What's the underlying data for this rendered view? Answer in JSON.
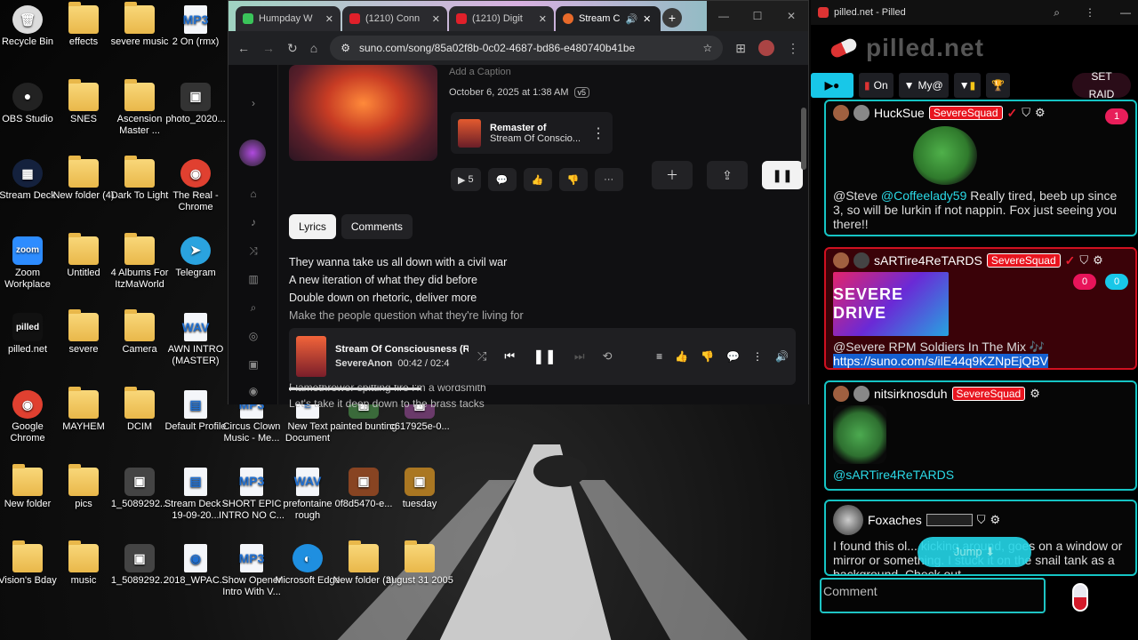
{
  "desktop": {
    "icons": [
      {
        "label": "Recycle Bin",
        "kind": "app",
        "glyph": "🗑",
        "color": "#dcdcdc"
      },
      {
        "label": "effects",
        "kind": "folder"
      },
      {
        "label": "severe music",
        "kind": "folder"
      },
      {
        "label": "2 On (rmx)",
        "kind": "file",
        "glyph": "MP3"
      },
      {
        "label": "OBS Studio",
        "kind": "app",
        "glyph": "●",
        "color": "#222"
      },
      {
        "label": "SNES",
        "kind": "folder"
      },
      {
        "label": "Ascension Master ...",
        "kind": "folder"
      },
      {
        "label": "photo_2020...",
        "kind": "sq",
        "glyph": "▣",
        "color": "#333"
      },
      {
        "label": "Stream Deck",
        "kind": "app",
        "glyph": "▦",
        "color": "#14213d"
      },
      {
        "label": "New folder (4)",
        "kind": "folder"
      },
      {
        "label": "Dark To Light",
        "kind": "folder"
      },
      {
        "label": "The Real - Chrome",
        "kind": "app",
        "glyph": "◉",
        "color": "#e04030"
      },
      {
        "label": "Zoom Workplace",
        "kind": "sq",
        "glyph": "zoom",
        "color": "#2d8cff"
      },
      {
        "label": "Untitled",
        "kind": "folder"
      },
      {
        "label": "4 Albums For ItzMaWorld",
        "kind": "folder"
      },
      {
        "label": "Telegram",
        "kind": "app",
        "glyph": "➤",
        "color": "#2aa3df"
      },
      {
        "label": "pilled.net",
        "kind": "sq",
        "glyph": "pilled",
        "color": "#111"
      },
      {
        "label": "severe",
        "kind": "folder"
      },
      {
        "label": "Camera",
        "kind": "folder"
      },
      {
        "label": "AWN INTRO (MASTER)",
        "kind": "file",
        "glyph": "WAV"
      },
      {
        "label": "Google Chrome",
        "kind": "app",
        "glyph": "◉",
        "color": "#e04030"
      },
      {
        "label": "MAYHEM",
        "kind": "folder"
      },
      {
        "label": "DCIM",
        "kind": "folder"
      },
      {
        "label": "Default Profile",
        "kind": "file",
        "glyph": "▤"
      },
      {
        "label": "Circus Clown Music - Me...",
        "kind": "file",
        "glyph": "MP3"
      },
      {
        "label": "New Text Document",
        "kind": "file",
        "glyph": "≡"
      },
      {
        "label": "painted bunting",
        "kind": "sq",
        "glyph": "▣",
        "color": "#3a6a3a"
      },
      {
        "label": "c617925e-0...",
        "kind": "sq",
        "glyph": "▣",
        "color": "#6a3a6a"
      },
      {
        "label": "New folder",
        "kind": "folder"
      },
      {
        "label": "pics",
        "kind": "folder"
      },
      {
        "label": "1_5089292...",
        "kind": "sq",
        "glyph": "▣",
        "color": "#444"
      },
      {
        "label": "Stream Deck - 19-09-20...",
        "kind": "file",
        "glyph": "▤"
      },
      {
        "label": "SHORT EPIC INTRO NO C...",
        "kind": "file",
        "glyph": "MP3"
      },
      {
        "label": "prefontaine rough",
        "kind": "file",
        "glyph": "WAV"
      },
      {
        "label": "0f8d5470-e...",
        "kind": "sq",
        "glyph": "▣",
        "color": "#884422"
      },
      {
        "label": "tuesday",
        "kind": "sq",
        "glyph": "▣",
        "color": "#aa7722"
      },
      {
        "label": "Vision's Bday",
        "kind": "folder"
      },
      {
        "label": "music",
        "kind": "folder"
      },
      {
        "label": "1_5089292...",
        "kind": "sq",
        "glyph": "▣",
        "color": "#444"
      },
      {
        "label": "2018_WPAC...",
        "kind": "file",
        "glyph": "◉"
      },
      {
        "label": "Show Opener Intro With V...",
        "kind": "file",
        "glyph": "MP3"
      },
      {
        "label": "Microsoft Edge",
        "kind": "app",
        "glyph": "◐",
        "color": "#1f8fe0"
      },
      {
        "label": "New folder (2)",
        "kind": "folder"
      },
      {
        "label": "august 31 2005",
        "kind": "folder"
      }
    ]
  },
  "browser": {
    "tabs": [
      {
        "label": "Humpday W",
        "color": "#3ac45a",
        "active": false
      },
      {
        "label": "(1210) Conn",
        "color": "#e0202a",
        "active": false
      },
      {
        "label": "(1210) Digit",
        "color": "#e0202a",
        "active": false
      },
      {
        "label": "Stream C",
        "color": "#e86a2a",
        "active": true
      }
    ],
    "url": "suno.com/song/85a02f8b-0c02-4687-bd86-e480740b41be"
  },
  "song": {
    "caption": "Add a Caption",
    "date": "October 6, 2025 at 1:38 AM",
    "version": "v5",
    "remaster_title": "Remaster of",
    "remaster_song": "Stream Of Conscio...",
    "play_count": "5",
    "tab_lyrics": "Lyrics",
    "tab_comments": "Comments",
    "lyrics": [
      "They wanna take us all down with a civil war",
      "A new iteration of what they did before",
      "Double down on rhetoric, deliver more",
      "Make the people question what they're living for"
    ],
    "lyrics_below": [
      "Flamethrower spitting fire I'm a wordsmith",
      "Let's take it deep down to the brass tacks"
    ]
  },
  "player": {
    "title": "Stream Of Consciousness (R",
    "artist": "SevereAnon",
    "time": "00:42 / 02:4",
    "progress": 0.26
  },
  "pilled": {
    "window_title": "pilled.net - Pilled",
    "logo": "pilled.net",
    "toolbar": {
      "on": "On",
      "my": "My@",
      "set": "SET",
      "raid": "RAID"
    },
    "messages": [
      {
        "user": "HuckSue",
        "squad": "SevereSquad",
        "text_prefix": "@Steve ",
        "mention": "@Coffeelady59",
        "text": " Really tired, beeb up since 3, so will be lurkin if not nappin. Fox just seeing you there!!",
        "badge": "1"
      },
      {
        "user": "sARTire4ReTARDS",
        "squad": "SevereSquad",
        "banner": "SEVERE DRIVE",
        "text": "@Severe RPM Soldiers In The Mix 🎶",
        "link": "https://suno.com/s/ilE44q9KZNpEjQBV",
        "badge_a": "0",
        "badge_b": "0"
      },
      {
        "user": "nitsirknosduh",
        "squad": "SevereSquad",
        "mention": "@sARTire4ReTARDS"
      },
      {
        "user": "Foxaches",
        "text": "I found this ol... kicking around, goes on a window or mirror or something. I stuck it on the snail tank as a background. Check out"
      }
    ],
    "jump": "Jump ⬇",
    "comment_placeholder": "Comment"
  }
}
